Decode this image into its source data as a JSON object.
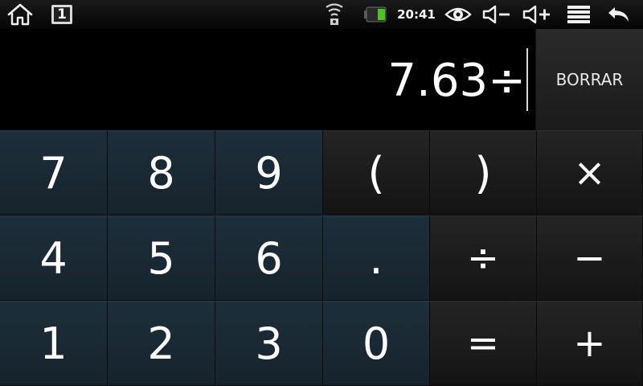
{
  "status_bar": {
    "time": "20:41",
    "notification_badge": "1",
    "icons": [
      "home-icon",
      "notification-icon",
      "wifi-icon",
      "battery-icon",
      "eye-icon",
      "volume-down-icon",
      "volume-up-icon",
      "menu-icon",
      "back-icon"
    ],
    "battery_color": "#4cc61e"
  },
  "display": {
    "expression": "7.63÷",
    "clear_label": "BORRAR"
  },
  "keypad": {
    "rows": [
      [
        "7",
        "8",
        "9",
        "(",
        ")",
        "×"
      ],
      [
        "4",
        "5",
        "6",
        ".",
        "÷",
        "−"
      ],
      [
        "1",
        "2",
        "3",
        "0",
        "=",
        "+"
      ]
    ]
  },
  "colors": {
    "number_key": "#1b2b36",
    "operator_key": "#1e1e1e",
    "background": "#000000"
  }
}
